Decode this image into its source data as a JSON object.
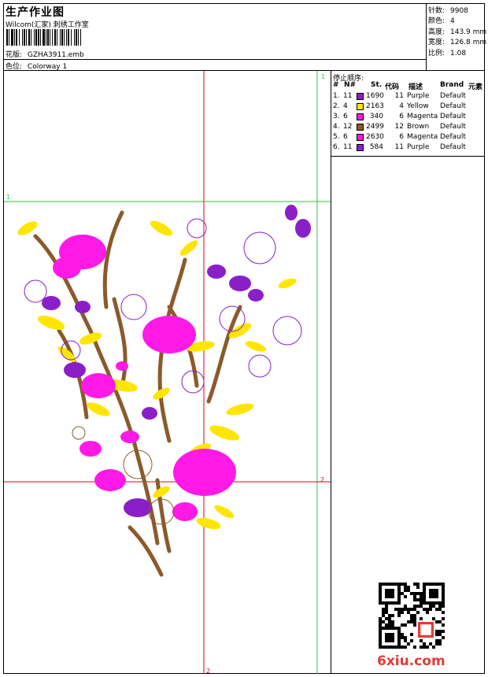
{
  "header": {
    "title": "生产作业图",
    "company": "Wilcom(汇家) 刺绣工作室",
    "design_label": "花版:",
    "design_value": "GZHA3911.emb",
    "colorway_label": "色位:",
    "colorway_value": "Colorway 1"
  },
  "stats": [
    {
      "label": "针数:",
      "value": "9908"
    },
    {
      "label": "颜色:",
      "value": "4"
    },
    {
      "label": "高度:",
      "value": "143.9 mm"
    },
    {
      "label": "宽度:",
      "value": "126.8 mm"
    },
    {
      "label": "比例:",
      "value": "1.08"
    }
  ],
  "stop_sequence": {
    "title": "停止顺序:",
    "columns": [
      "#",
      "N#",
      "St.",
      "代码",
      "描述",
      "Brand",
      "元素"
    ],
    "rows": [
      {
        "idx": "1.",
        "needle": "11",
        "color": "#8a1fc7",
        "stitches": "1690",
        "code": "11",
        "desc": "Purple",
        "brand": "Default"
      },
      {
        "idx": "2.",
        "needle": "4",
        "color": "#ffe600",
        "stitches": "2163",
        "code": "4",
        "desc": "Yellow",
        "brand": "Default"
      },
      {
        "idx": "3.",
        "needle": "6",
        "color": "#ff19e6",
        "stitches": "340",
        "code": "6",
        "desc": "Magenta",
        "brand": "Default"
      },
      {
        "idx": "4.",
        "needle": "12",
        "color": "#8b5a2b",
        "stitches": "2499",
        "code": "12",
        "desc": "Brown",
        "brand": "Default"
      },
      {
        "idx": "5.",
        "needle": "6",
        "color": "#ff19e6",
        "stitches": "2630",
        "code": "6",
        "desc": "Magenta",
        "brand": "Default"
      },
      {
        "idx": "6.",
        "needle": "11",
        "color": "#8a1fc7",
        "stitches": "584",
        "code": "11",
        "desc": "Purple",
        "brand": "Default"
      }
    ]
  },
  "guides": {
    "top_right": "1",
    "left": "1",
    "right_mid": "2",
    "bottom": "2"
  },
  "watermark": "6xiu.com",
  "colors": {
    "guide_red": "#e0001b",
    "guide_green": "#27c93f",
    "purple": "#8a1fc7",
    "yellow": "#ffe600",
    "magenta": "#ff19e6",
    "brown": "#8b5a2b"
  }
}
